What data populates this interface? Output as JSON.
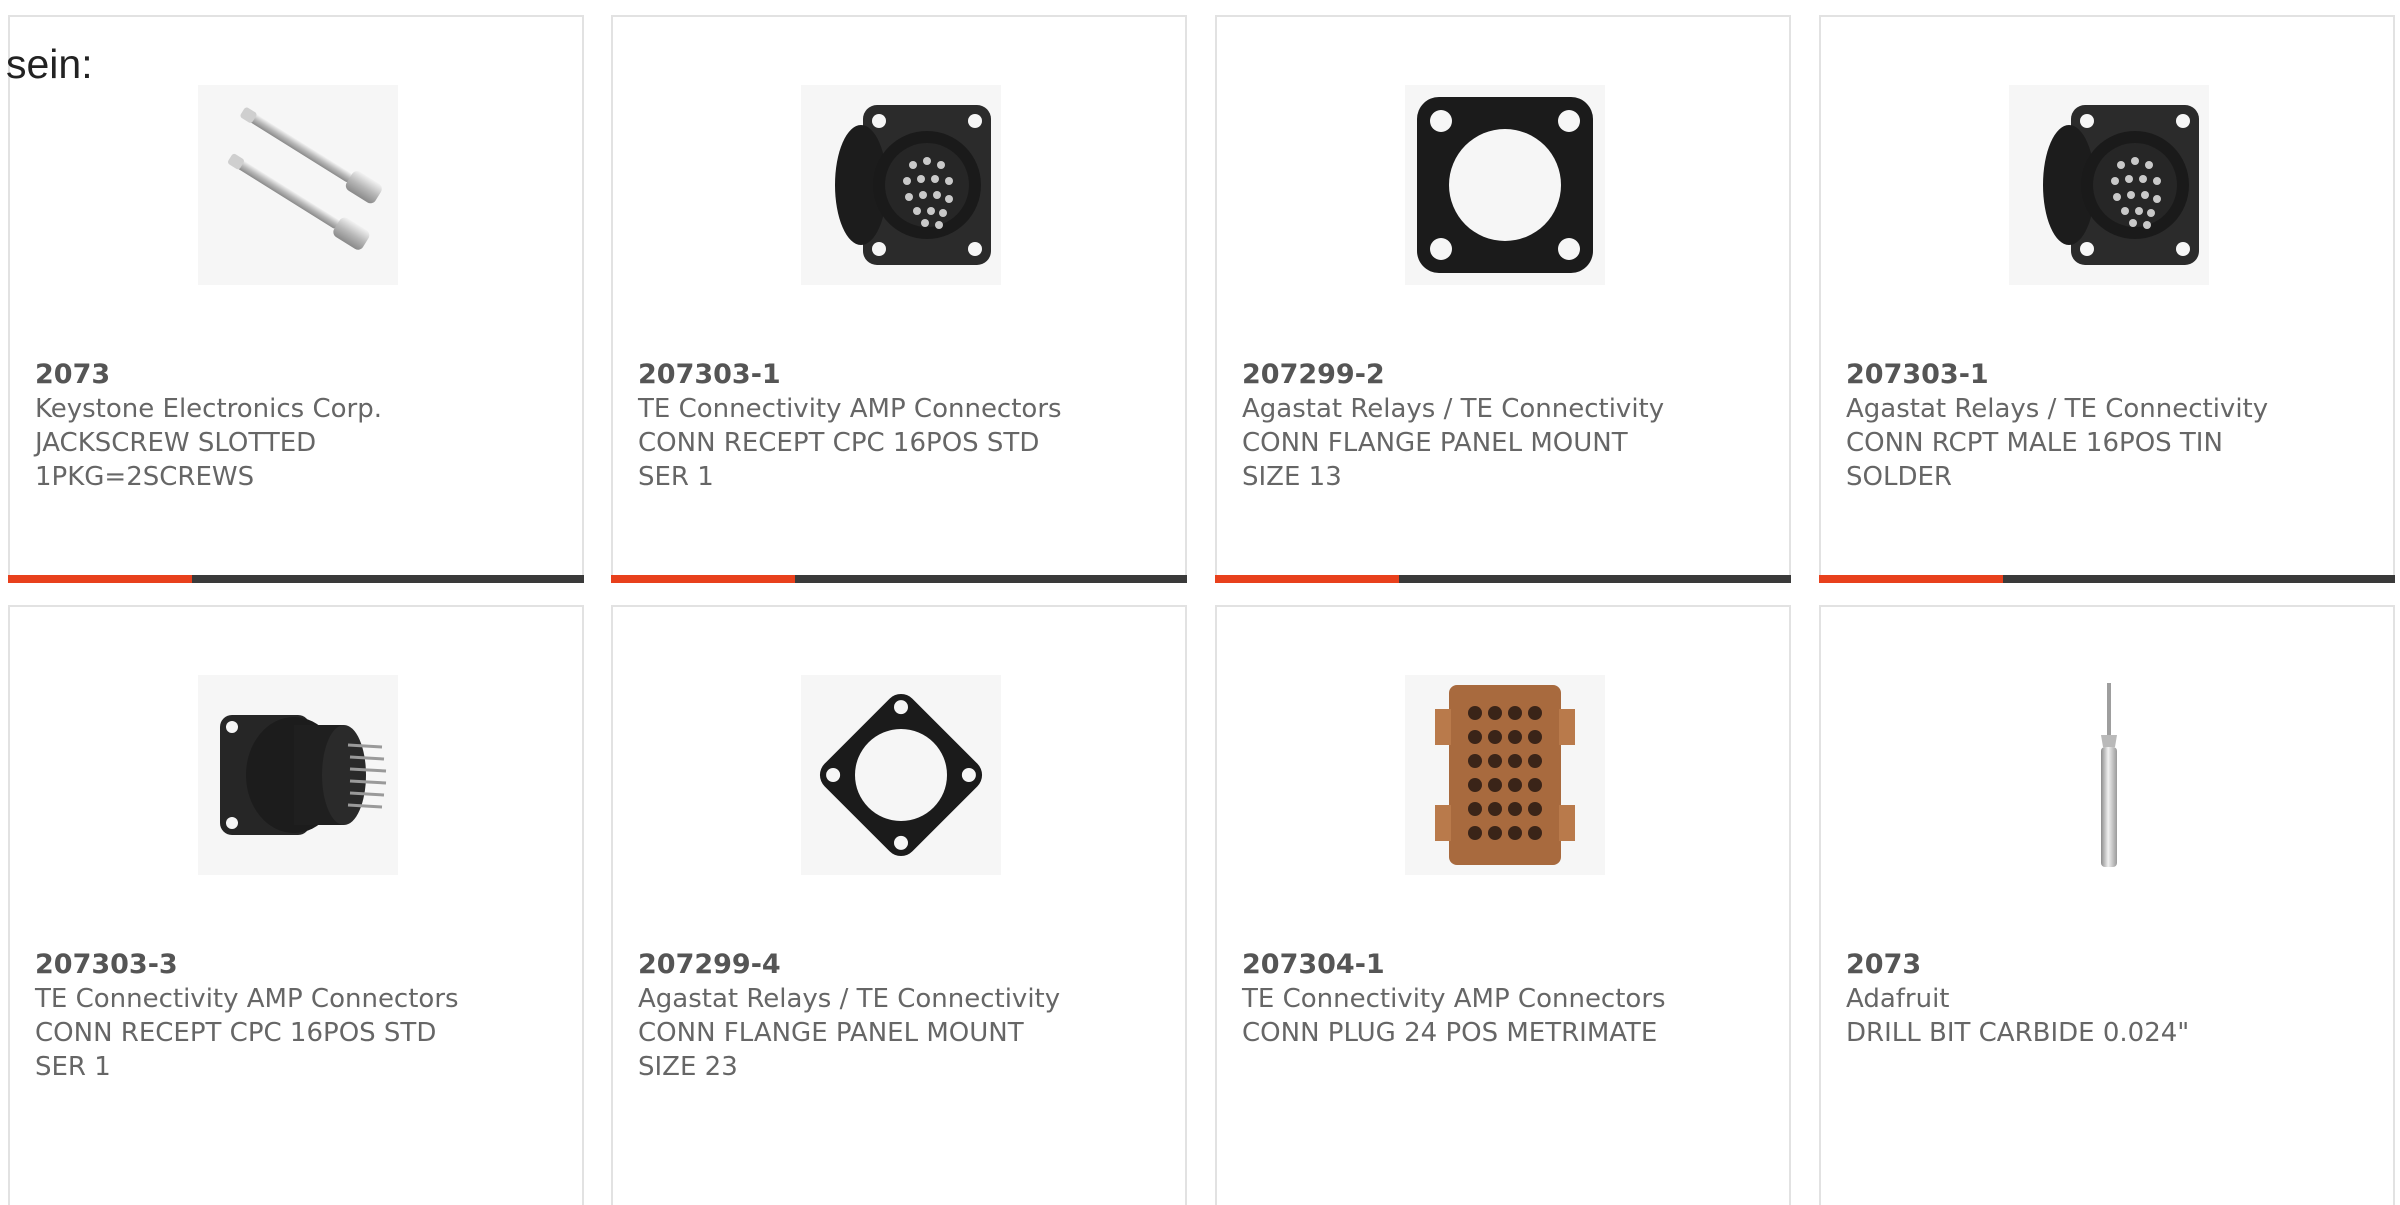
{
  "intro": {
    "text": "sein:"
  },
  "accent_color": "#e8401c",
  "bar_color": "#3a3a3a",
  "products": [
    {
      "part_number": "2073",
      "manufacturer": "Keystone Electronics Corp.",
      "description": "JACKSCREW SLOTTED 1PKG=2SCREWS",
      "image": "jackscrew-image",
      "highlight_fraction": 0.32
    },
    {
      "part_number": "207303-1",
      "manufacturer": "TE Connectivity AMP Connectors",
      "description": "CONN RECEPT CPC 16POS STD SER 1",
      "image": "circular-connector-image",
      "highlight_fraction": 0.32
    },
    {
      "part_number": "207299-2",
      "manufacturer": "Agastat Relays / TE Connectivity",
      "description": "CONN FLANGE PANEL MOUNT SIZE 13",
      "image": "flange-image",
      "highlight_fraction": 0.32
    },
    {
      "part_number": "207303-1",
      "manufacturer": "Agastat Relays / TE Connectivity",
      "description": "CONN RCPT MALE 16POS TIN SOLDER",
      "image": "circular-connector-image",
      "highlight_fraction": 0.32
    },
    {
      "part_number": "207303-3",
      "manufacturer": "TE Connectivity AMP Connectors",
      "description": "CONN RECEPT CPC 16POS STD SER 1",
      "image": "circular-connector-side-image",
      "highlight_fraction": null
    },
    {
      "part_number": "207299-4",
      "manufacturer": "Agastat Relays / TE Connectivity",
      "description": "CONN FLANGE PANEL MOUNT SIZE 23",
      "image": "tilted-flange-image",
      "highlight_fraction": null
    },
    {
      "part_number": "207304-1",
      "manufacturer": "TE Connectivity AMP Connectors",
      "description": "CONN PLUG 24 POS METRIMATE",
      "image": "plug-connector-image",
      "highlight_fraction": null
    },
    {
      "part_number": "2073",
      "manufacturer": "Adafruit",
      "description": "DRILL BIT CARBIDE 0.024\"",
      "image": "drill-bit-image",
      "highlight_fraction": null
    }
  ]
}
